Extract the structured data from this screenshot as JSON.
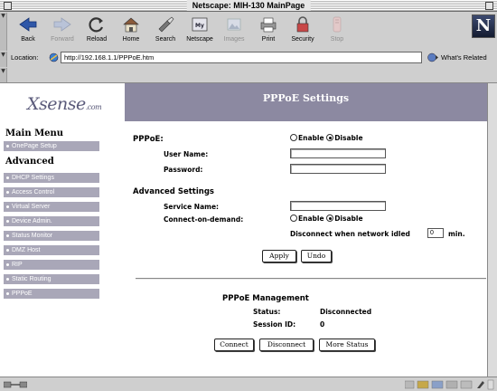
{
  "window": {
    "title": "Netscape: MIH-130 MainPage"
  },
  "toolbar": {
    "back": "Back",
    "forward": "Forward",
    "reload": "Reload",
    "home": "Home",
    "search": "Search",
    "netscape": "Netscape",
    "images": "Images",
    "print": "Print",
    "security": "Security",
    "stop": "Stop"
  },
  "location": {
    "label": "Location:",
    "url": "http://192.168.1.1/PPPoE.htm",
    "whats_related": "What's Related"
  },
  "logo": {
    "brand": "Xsense",
    "suffix": ".com"
  },
  "header": {
    "title": "PPPoE Settings"
  },
  "sidebar": {
    "main_menu": "Main Menu",
    "onepage_setup": "OnePage Setup",
    "advanced": "Advanced",
    "items": [
      "DHCP Settings",
      "Access Control",
      "Virtual Server",
      "Device Admin.",
      "Status Monitor",
      "DMZ Host",
      "RIP",
      "Static Routing",
      "PPPoE"
    ]
  },
  "form": {
    "pppoe_label": "PPPoE:",
    "enable": "Enable",
    "disable": "Disable",
    "pppoe_mode": "Disable",
    "user_name_label": "User Name:",
    "user_name_value": "",
    "password_label": "Password:",
    "password_value": "",
    "advanced_heading": "Advanced Settings",
    "service_name_label": "Service Name:",
    "service_name_value": "",
    "cod_label": "Connect-on-demand:",
    "cod_mode": "Disable",
    "idle_prefix": "Disconnect when network idled",
    "idle_value": "0",
    "idle_suffix": "min.",
    "apply": "Apply",
    "undo": "Undo"
  },
  "management": {
    "title": "PPPoE Management",
    "status_label": "Status:",
    "status_value": "Disconnected",
    "session_label": "Session ID:",
    "session_value": "0",
    "connect": "Connect",
    "disconnect": "Disconnect",
    "more_status": "More Status"
  },
  "colors": {
    "header_band": "#8c89a1",
    "menu_item_bg": "#a9a7b8",
    "chrome": "#cfcfcf"
  }
}
